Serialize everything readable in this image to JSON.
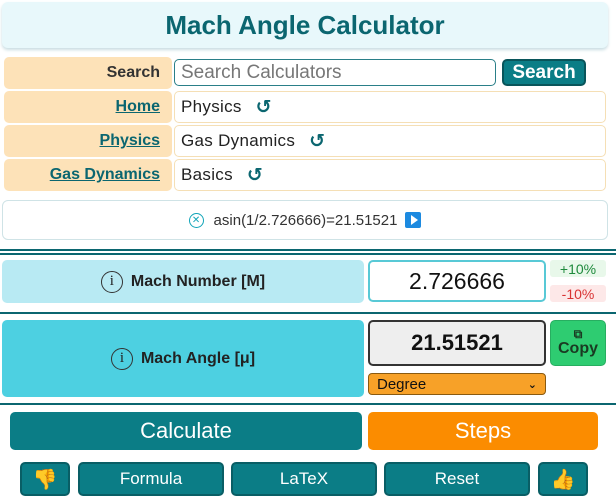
{
  "title": "Mach Angle Calculator",
  "search": {
    "label": "Search",
    "placeholder": "Search Calculators",
    "button": "Search"
  },
  "breadcrumbs": [
    {
      "link": "Home",
      "value": "Physics"
    },
    {
      "link": "Physics",
      "value": "Gas Dynamics"
    },
    {
      "link": "Gas Dynamics",
      "value": "Basics"
    }
  ],
  "reload_glyph": "↺",
  "formula_text": "asin(1/2.726666)=21.51521",
  "input": {
    "label": "Mach Number [M]",
    "value": "2.726666",
    "plus": "+10%",
    "minus": "-10%"
  },
  "output": {
    "label": "Mach Angle [μ]",
    "value": "21.51521",
    "copy_label": "Copy",
    "unit": "Degree"
  },
  "actions": {
    "calculate": "Calculate",
    "steps": "Steps",
    "formula": "Formula",
    "latex": "LaTeX",
    "reset": "Reset"
  },
  "colors": {
    "teal": "#0b7d86",
    "orange": "#fb8c00",
    "green": "#2ecc71",
    "light_cyan": "#b8eaf3",
    "cyan": "#4dd0e1",
    "peach": "#fde2b8"
  },
  "icons": [
    "info-icon",
    "clear-icon",
    "play-icon",
    "reload-icon",
    "copy-icon",
    "thumbs-down-icon",
    "thumbs-up-icon",
    "chevron-down-icon"
  ]
}
